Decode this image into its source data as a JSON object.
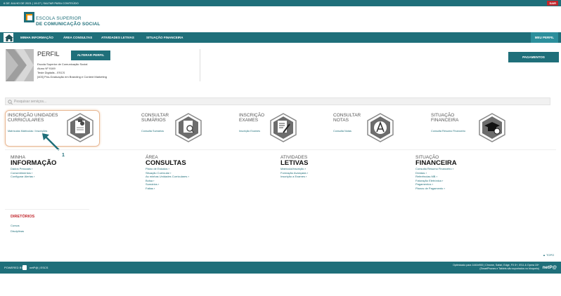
{
  "topbar": {
    "date": "6 DE JULHO DE 2021 | 19:27",
    "skip": "SALTAR PARA CONTEÚDO",
    "logout": "SAIR"
  },
  "brand": {
    "line1": "ESCOLA SUPERIOR",
    "line2": "DE COMUNICAÇÃO SOCIAL"
  },
  "nav": {
    "items": [
      "MINHA INFORMAÇÃO",
      "ÁREA CONSULTAS",
      "ATIVIDADES LETIVAS",
      "SITUAÇÃO FINANCEIRA"
    ],
    "profile": "MEU PERFIL"
  },
  "profile": {
    "title": "PERFIL",
    "change_button": "ALTERAR PERFIL",
    "lines": [
      "Escola Superior de Comunicação Social",
      "Aluno Nº 9169",
      "Teste Digitalis - ESCS",
      "[403] Pós-Graduação em Branding e Content Marketing"
    ],
    "payments_button": "PAGAMENTOS"
  },
  "search": {
    "placeholder": "Pesquisar serviços..."
  },
  "tiles": [
    {
      "title": "INSCRIÇÃO UNIDADES",
      "title2": "CURRICULARES",
      "link": "Matrículas Matrículas / Inscrições",
      "icon": "clipboard-check-icon"
    },
    {
      "title": "CONSULTAR",
      "title2": "SUMÁRIOS",
      "link": "Consulta Sumários",
      "icon": "document-search-icon"
    },
    {
      "title": "INSCRIÇÃO",
      "title2": "EXAMES",
      "link": "Inscrição Exames",
      "icon": "exam-edit-icon"
    },
    {
      "title": "CONSULTAR",
      "title2": "NOTAS",
      "link": "Consulta Notas",
      "icon": "grade-a-icon"
    },
    {
      "title": "SITUAÇÃO",
      "title2": "FINANCEIRA",
      "link": "Consulta Resumo Financeiro",
      "icon": "graduation-money-icon"
    }
  ],
  "annotation": {
    "number": "1"
  },
  "sections": [
    {
      "h1": "MINHA",
      "h2": "INFORMAÇÃO",
      "links": [
        "Dados Pessoais",
        "Consentimentos",
        "Configurar Alertas"
      ]
    },
    {
      "h1": "ÁREA",
      "h2": "CONSULTAS",
      "links": [
        "Plano de Estudos",
        "Situação Curricular",
        "As minhas Unidades Curriculares",
        "Bolsa",
        "Sumários",
        "Faltas"
      ]
    },
    {
      "h1": "ATIVIDADES",
      "h2": "LETIVAS",
      "links": [
        "Matrícula/Inscrição",
        "Formação Avançada",
        "Inscrição a Exames"
      ]
    },
    {
      "h1": "SITUAÇÃO",
      "h2": "FINANCEIRA",
      "links": [
        "Consulta Resumo Financeiro",
        "Dívidas",
        "Referências MB",
        "Faturação Eletrónica",
        "Pagamentos",
        "Planos de Pagamento"
      ]
    }
  ],
  "directories": {
    "title": "DIRETÓRIOS",
    "links": [
      "Cursos",
      "Disciplinas"
    ]
  },
  "topo": "TOPO",
  "footer": {
    "powered": "POWERED BY",
    "partner": "netP@ | ESCS",
    "optimized1": "Optimizado para 1440x900 | Chrome, Safari, Edge, FX 5+, IE11 & Opera 15+",
    "optimized2": "(SmartPhones e Tablets são suportados no bloqueio)",
    "brand": "netP@"
  }
}
